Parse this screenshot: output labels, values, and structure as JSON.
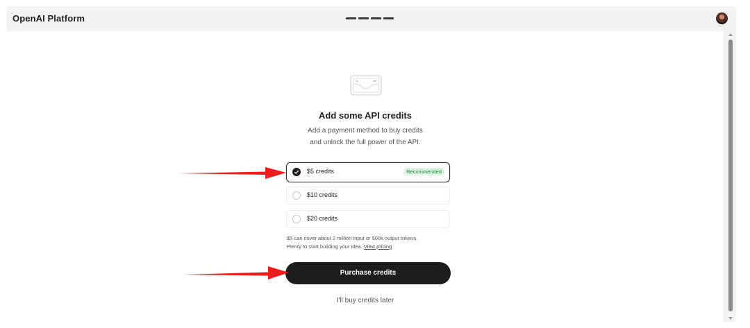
{
  "header": {
    "logo": "OpenAI  Platform"
  },
  "credits": {
    "title": "Add some API credits",
    "subtitle_line1": "Add a payment method to buy credits",
    "subtitle_line2": "and unlock the full power of the API.",
    "options": [
      {
        "label": "$5 credits",
        "selected": true,
        "badge": "Recommended"
      },
      {
        "label": "$10 credits",
        "selected": false
      },
      {
        "label": "$20 credits",
        "selected": false
      }
    ],
    "note_line1": "$5 can cover about 2 million input or 500k output tokens.",
    "note_line2": "Plenty to start building your idea.",
    "pricing_link": "View pricing",
    "purchase_label": "Purchase credits",
    "later_label": "I'll buy credits later"
  },
  "colors": {
    "arrow": "#ee1c1c",
    "primary_button": "#1d1d1d",
    "badge_bg": "#dff5e3",
    "badge_text": "#1e8a3c"
  }
}
